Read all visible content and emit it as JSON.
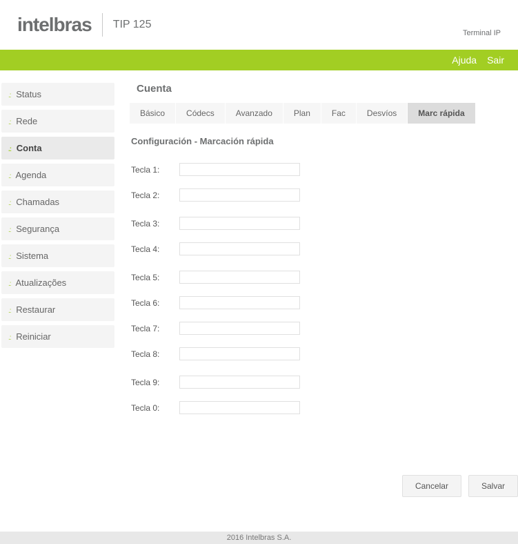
{
  "header": {
    "logo": "intelbras",
    "model_prefix": "TIP",
    "model_suffix": "125",
    "terminal_ip": "Terminal IP"
  },
  "topbar": {
    "help": "Ajuda",
    "logout": "Sair"
  },
  "sidebar": {
    "items": [
      {
        "label": "Status",
        "active": false
      },
      {
        "label": "Rede",
        "active": false
      },
      {
        "label": "Conta",
        "active": true
      },
      {
        "label": "Agenda",
        "active": false
      },
      {
        "label": "Chamadas",
        "active": false
      },
      {
        "label": "Segurança",
        "active": false
      },
      {
        "label": "Sistema",
        "active": false
      },
      {
        "label": "Atualizações",
        "active": false
      },
      {
        "label": "Restaurar",
        "active": false
      },
      {
        "label": "Reiniciar",
        "active": false
      }
    ]
  },
  "page": {
    "title": "Cuenta",
    "tabs": [
      {
        "label": "Básico",
        "active": false
      },
      {
        "label": "Códecs",
        "active": false
      },
      {
        "label": "Avanzado",
        "active": false
      },
      {
        "label": "Plan",
        "active": false
      },
      {
        "label": "Fac",
        "active": false
      },
      {
        "label": "Desvíos",
        "active": false
      },
      {
        "label": "Marc rápida",
        "active": true
      }
    ],
    "section_title": "Configuración - Marcación rápida",
    "rows": [
      {
        "label": "Tecla 1:",
        "value": ""
      },
      {
        "label": "Tecla 2:",
        "value": ""
      },
      {
        "label": "Tecla 3:",
        "value": ""
      },
      {
        "label": "Tecla 4:",
        "value": ""
      },
      {
        "label": "Tecla 5:",
        "value": ""
      },
      {
        "label": "Tecla 6:",
        "value": ""
      },
      {
        "label": "Tecla 7:",
        "value": ""
      },
      {
        "label": "Tecla 8:",
        "value": ""
      },
      {
        "label": "Tecla 9:",
        "value": ""
      },
      {
        "label": "Tecla 0:",
        "value": ""
      }
    ],
    "buttons": {
      "cancel": "Cancelar",
      "save": "Salvar"
    }
  },
  "footer": {
    "copyright": "2016 Intelbras S.A."
  }
}
